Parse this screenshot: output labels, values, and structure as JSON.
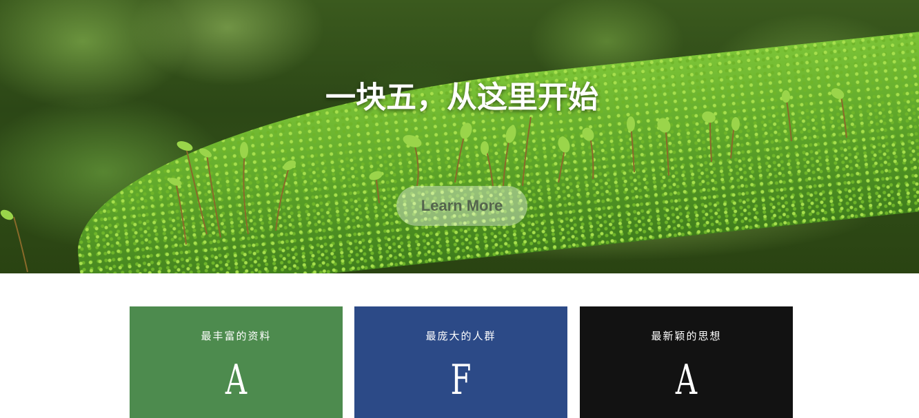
{
  "hero": {
    "title": "一块五，从这里开始",
    "cta_label": "Learn More"
  },
  "features": [
    {
      "title": "最丰富的资料",
      "letter": "A",
      "color": "#4d8b4e"
    },
    {
      "title": "最庞大的人群",
      "letter": "F",
      "color": "#2c4a87"
    },
    {
      "title": "最新颖的思想",
      "letter": "A",
      "color": "#121212"
    }
  ]
}
